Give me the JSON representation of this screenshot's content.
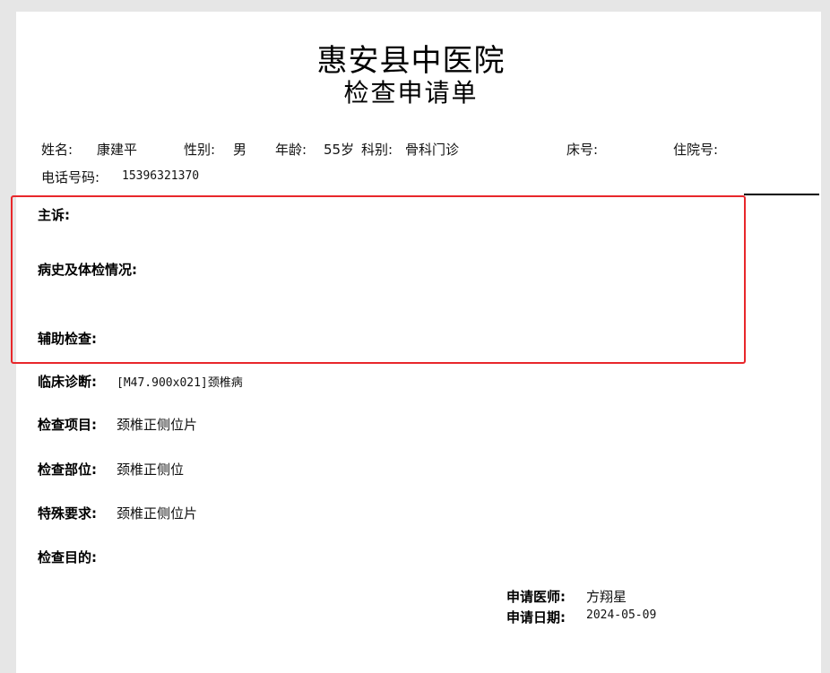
{
  "hospital_name": "惠安县中医院",
  "form_title": "检查申请单",
  "patient": {
    "name_label": "姓名:",
    "name_value": "康建平",
    "gender_label": "性别:",
    "gender_value": "男",
    "age_label": "年龄:",
    "age_value": "55岁",
    "dept_label": "科别:",
    "dept_value": "骨科门诊",
    "bed_label": "床号:",
    "inpatient_label": "住院号:",
    "phone_label": "电话号码:",
    "phone_value": "15396321370"
  },
  "sections": {
    "chief_complaint_label": "主诉:",
    "history_label": "病史及体检情况:",
    "auxiliary_label": "辅助检查:",
    "diagnosis_label": "临床诊断:",
    "diagnosis_value": "[M47.900x021]颈椎病",
    "exam_item_label": "检查项目:",
    "exam_item_value": "颈椎正侧位片",
    "exam_part_label": "检查部位:",
    "exam_part_value": "颈椎正侧位",
    "special_label": "特殊要求:",
    "special_value": "颈椎正侧位片",
    "purpose_label": "检查目的:"
  },
  "footer": {
    "doctor_label": "申请医师:",
    "doctor_value": "方翔星",
    "date_label": "申请日期:",
    "date_value": "2024-05-09"
  },
  "colors": {
    "highlight_border": "#e8272b",
    "page_background": "#ffffff",
    "viewer_background": "#e6e6e6"
  }
}
